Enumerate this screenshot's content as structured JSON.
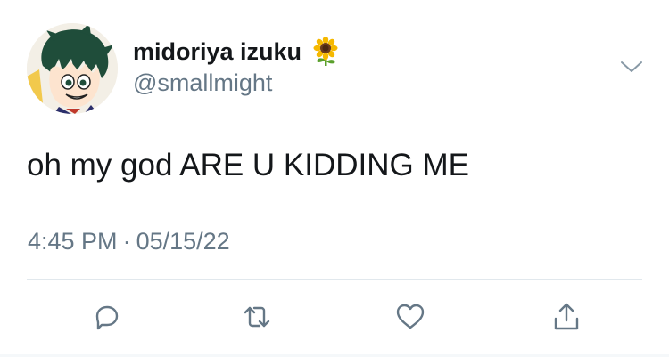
{
  "user": {
    "display_name": "midoriya izuku",
    "name_emoji": "sunflower-icon",
    "handle": "@smallmight",
    "avatar": "avatar"
  },
  "tweet": {
    "text": "oh my god ARE U KIDDING ME",
    "time": "4:45 PM",
    "separator": "·",
    "date": "05/15/22"
  },
  "actions": [
    {
      "name": "reply-icon"
    },
    {
      "name": "retweet-icon"
    },
    {
      "name": "like-icon"
    },
    {
      "name": "share-icon"
    }
  ],
  "menu": {
    "icon": "chevron-down-icon"
  },
  "colors": {
    "text": "#14171a",
    "secondary": "#657786",
    "divider": "#e1e8ed",
    "icon": "#657786"
  }
}
